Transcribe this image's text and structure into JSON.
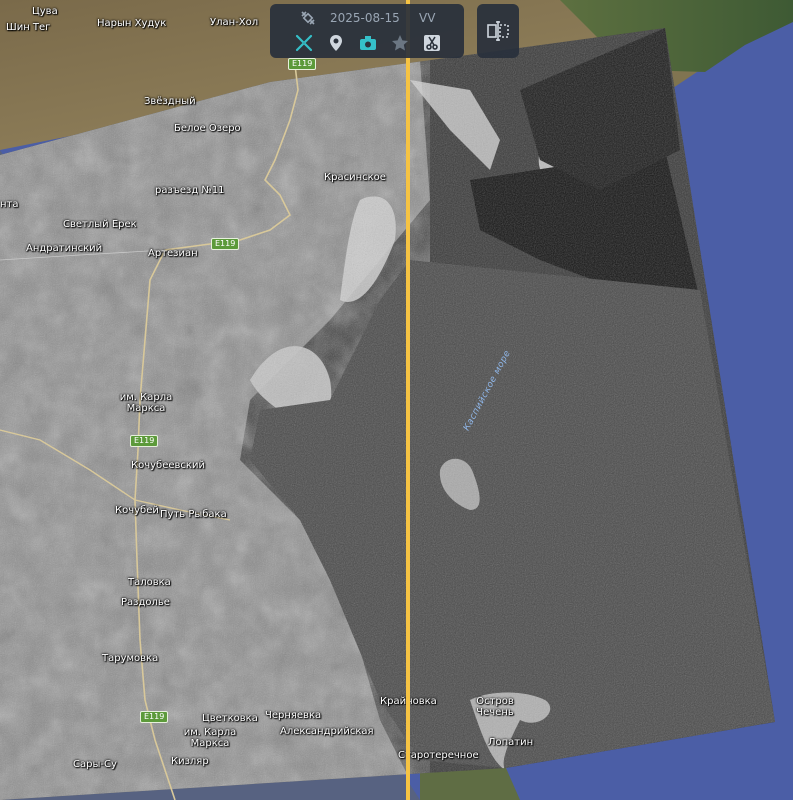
{
  "toolbar": {
    "date": "2025-08-15",
    "polarization": "VV",
    "icons": [
      "satellite-icon",
      "swipe-icon",
      "location-pin-icon",
      "camera-icon",
      "star-icon",
      "scissors-icon"
    ],
    "accent_color": "#35c0c9"
  },
  "compare_button": {
    "icon": "split-compare-icon"
  },
  "divider_color": "#f6c343",
  "map": {
    "water_body": "Каспийское море",
    "roads": [
      "E119",
      "E119",
      "E119",
      "E119"
    ],
    "places": [
      "Цува",
      "Шин Тег",
      "Нарын Худук",
      "Улан-Хол",
      "Звёздный",
      "Белое Озеро",
      "разъезд №11",
      "Красинское",
      "Светлый Ерек",
      "нта",
      "Андратинский",
      "Артезиан",
      "им. Карла\nМаркса",
      "Кочубеевский",
      "Кочубей",
      "Путь Рыбака",
      "Таловка",
      "Раздолье",
      "Тарумовка",
      "Цветковка",
      "Черняевка",
      "им. Карла\nМаркса",
      "Александрийская",
      "Крайновка",
      "Остров\nЧечень",
      "Лопатин",
      "Сары-Су",
      "Кизляр",
      "Старотеречное"
    ]
  }
}
